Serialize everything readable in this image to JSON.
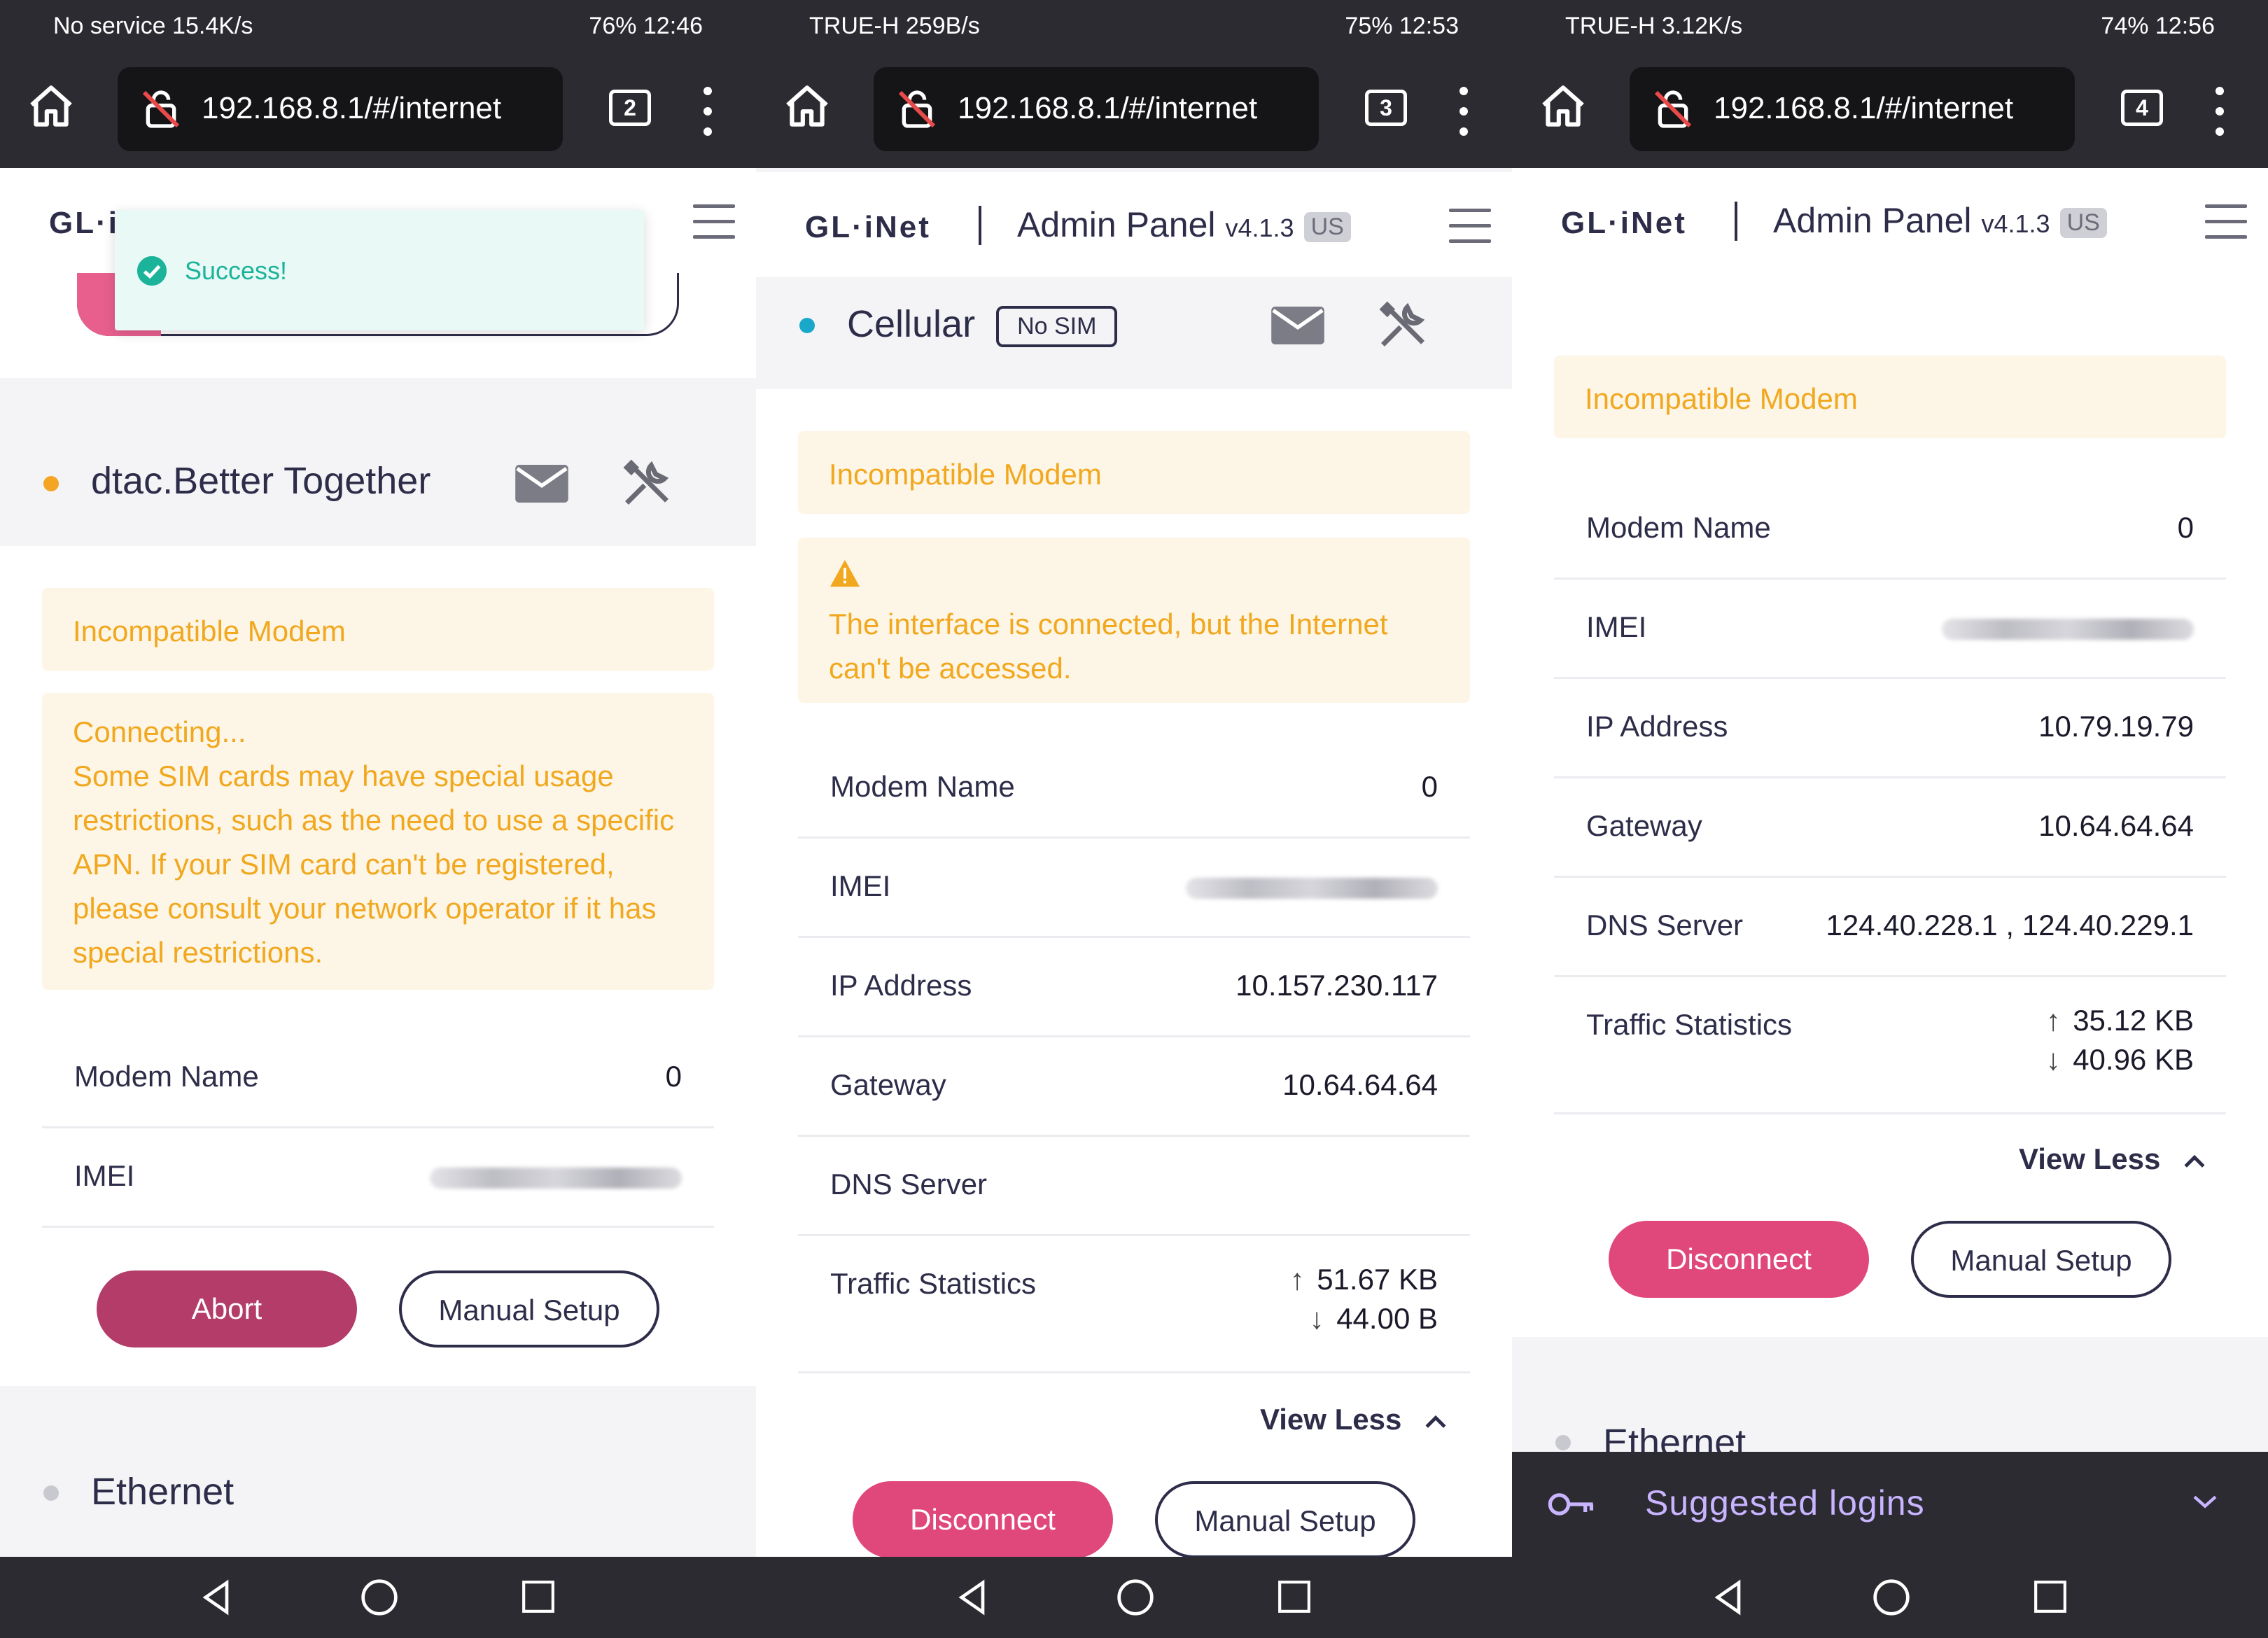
{
  "panels": [
    {
      "status_left": "No service  15.4K/s",
      "status_right": "76%  12:46",
      "url": "192.168.8.1/#/internet",
      "tab_count": "2",
      "logo": "GL·i",
      "toast": "Success!",
      "card_title": "dtac.Better Together",
      "warn_title": "Incompatible Modem",
      "warn_body": "Connecting...\nSome SIM cards may have special usage restrictions, such as the need to use a specific APN. If your SIM card can't be registered, please consult your network operator if it has special restrictions.",
      "rows": [
        {
          "key": "Modem Name",
          "value": "0"
        },
        {
          "key": "IMEI",
          "value": ""
        }
      ],
      "btn_primary": "Abort",
      "btn_secondary": "Manual Setup",
      "next_card": "Ethernet"
    },
    {
      "status_left": "TRUE-H  259B/s",
      "status_right": "75%  12:53",
      "url": "192.168.8.1/#/internet",
      "tab_count": "3",
      "logo": "GL·iNet",
      "admin": "Admin Panel",
      "version": "v4.1.3",
      "region": "US",
      "card_title": "Cellular",
      "badge": "No SIM",
      "warn_title": "Incompatible Modem",
      "warn_body": "The interface is connected, but the Internet can't be accessed.",
      "rows": [
        {
          "key": "Modem Name",
          "value": "0"
        },
        {
          "key": "IMEI",
          "value": ""
        },
        {
          "key": "IP Address",
          "value": "10.157.230.117"
        },
        {
          "key": "Gateway",
          "value": "10.64.64.64"
        },
        {
          "key": "DNS Server",
          "value": ""
        }
      ],
      "traffic": {
        "key": "Traffic Statistics",
        "up": "51.67 KB",
        "down": "44.00 B"
      },
      "view_less": "View Less",
      "btn_primary": "Disconnect",
      "btn_secondary": "Manual Setup"
    },
    {
      "status_left": "TRUE-H  3.12K/s",
      "status_right": "74%  12:56",
      "url": "192.168.8.1/#/internet",
      "tab_count": "4",
      "logo": "GL·iNet",
      "admin": "Admin Panel",
      "version": "v4.1.3",
      "region": "US",
      "warn_title": "Incompatible Modem",
      "rows": [
        {
          "key": "Modem Name",
          "value": "0"
        },
        {
          "key": "IMEI",
          "value": ""
        },
        {
          "key": "IP Address",
          "value": "10.79.19.79"
        },
        {
          "key": "Gateway",
          "value": "10.64.64.64"
        },
        {
          "key": "DNS Server",
          "value": "124.40.228.1 , 124.40.229.1"
        }
      ],
      "traffic": {
        "key": "Traffic Statistics",
        "up": "35.12 KB",
        "down": "40.96 KB"
      },
      "view_less": "View Less",
      "btn_primary": "Disconnect",
      "btn_secondary": "Manual Setup",
      "next_card": "Ethernet",
      "suggested": "Suggested logins"
    }
  ],
  "colors": {
    "accent": "#e0477b",
    "abort": "#b33c68",
    "warn_text": "#f1a81e",
    "warn_bg": "#fdf5e6",
    "dot_orange": "#f5a524",
    "dot_cyan": "#19a8c9",
    "toast_green": "#1bb39a"
  },
  "icons": [
    "home-icon",
    "lock-off-icon",
    "tabs-icon",
    "more-vert-icon",
    "hamburger-icon",
    "envelope-icon",
    "tools-icon",
    "warning-icon",
    "check-circle-icon",
    "arrow-up-icon",
    "arrow-down-icon",
    "chevron-up-icon",
    "key-icon",
    "chevron-down-icon",
    "nav-back-icon",
    "nav-home-icon",
    "nav-recent-icon"
  ]
}
